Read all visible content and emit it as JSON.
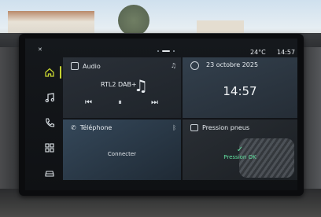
{
  "status": {
    "temperature": "24°C",
    "time": "14:57"
  },
  "audio": {
    "title": "Audio",
    "station": "RTL2 DAB+"
  },
  "datetime": {
    "date": "23 octobre 2025",
    "time": "14:57"
  },
  "phone": {
    "title": "Téléphone",
    "action": "Connecter"
  },
  "tires": {
    "title": "Pression pneus",
    "status": "Pression OK"
  },
  "colors": {
    "accent": "#c7d431",
    "ok": "#63e0a0"
  }
}
